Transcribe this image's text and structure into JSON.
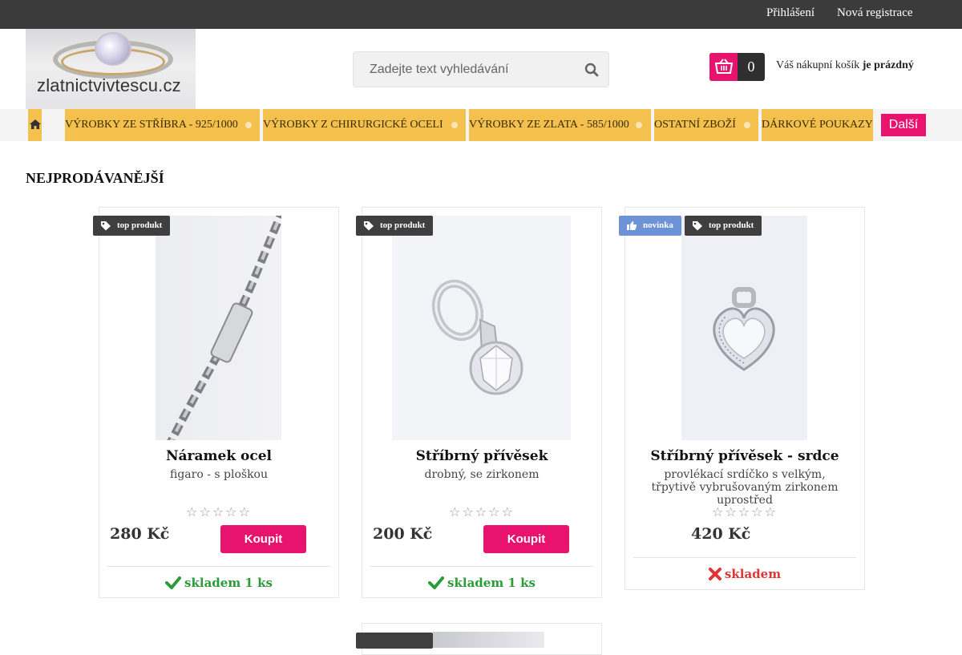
{
  "topbar": {
    "login": "Přihlášení",
    "register": "Nová registrace"
  },
  "logo": {
    "text": "zlatnictvivtescu.cz"
  },
  "search": {
    "placeholder": "Zadejte text vyhledávání"
  },
  "cart": {
    "count": "0",
    "label": "Váš nákupní košík",
    "status": "je prázdný"
  },
  "nav": {
    "items": [
      "VÝROBKY ZE STŘÍBRA - 925/1000",
      "VÝROBKY Z CHIRURGICKÉ OCELI",
      "VÝROBKY ZE ZLATA - 585/1000",
      "OSTATNÍ ZBOŽÍ",
      "DÁRKOVÉ POUKAZY"
    ],
    "more": "Další"
  },
  "section_title": "NEJPRODÁVANĚJŠÍ",
  "products": [
    {
      "badges": [
        "top produkt"
      ],
      "name": "Náramek ocel",
      "desc": "figaro - s ploškou",
      "rating": "☆☆☆☆☆",
      "price": "280 Kč",
      "buy": "Koupit",
      "stock": "skladem 1 ks"
    },
    {
      "badges": [
        "top produkt"
      ],
      "name": "Stříbrný přívěsek",
      "desc": "drobný, se zirkonem",
      "rating": "☆☆☆☆☆",
      "price": "200 Kč",
      "buy": "Koupit",
      "stock": "skladem 1 ks"
    },
    {
      "badges": [
        "novinka",
        "top produkt"
      ],
      "name": "Stříbrný přívěsek - srdce",
      "desc": "provlékací srdíčko s velkým, třpytivě vybrušovaným zirkonem uprostřed",
      "rating": "☆☆☆☆☆",
      "price": "420 Kč",
      "stock": "skladem"
    }
  ],
  "colors": {
    "accent": "#e8126f",
    "nav": "#f4c14f",
    "topbar": "#3b3b3b",
    "in_stock": "#2b9b3a",
    "out_of_stock": "#e03535",
    "badge_new": "#6d93d6"
  }
}
